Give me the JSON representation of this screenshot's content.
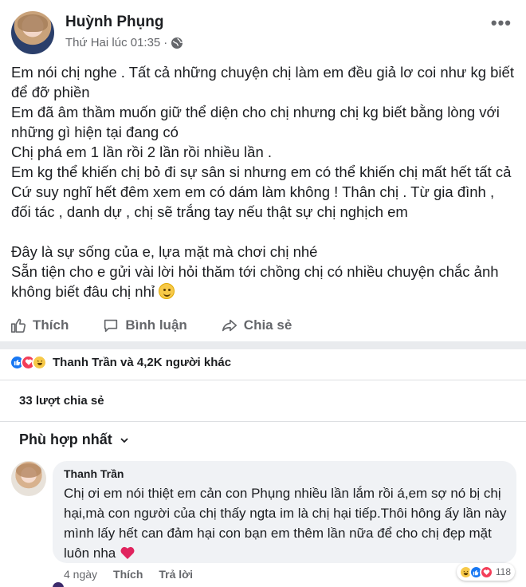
{
  "post": {
    "author": "Huỳnh Phụng",
    "timestamp": "Thứ Hai lúc 01:35",
    "separator": "·",
    "privacy_icon": "globe-icon",
    "more_icon": "more-options-icon",
    "body_lines": [
      "Em nói chị nghe . Tất cả những chuyện chị làm em đều giả lơ coi như kg biết để đỡ phiền",
      "Em đã âm thầm muốn giữ thể diện cho chị nhưng chị kg biết bằng lòng với những gì hiện tại đang có",
      "Chị phá em 1 lần rồi 2 lần rồi nhiều lần .",
      "Em kg thể khiến chị bỏ đi sự sân si nhưng em có thể khiến chị mất hết tất cả",
      "Cứ suy nghĩ hết đêm xem em có dám làm không ! Thân chị . Từ gia đình , đối tác , danh dự , chị sẽ trắng tay nếu thật sự chị nghịch em",
      "",
      "Đây là sự sống của e, lựa mặt mà chơi chị nhé",
      "Sẵn tiện cho e gửi vài lời hỏi thăm tới chồng chị có nhiều chuyện chắc ảnh không biết đâu chị nhỉ"
    ]
  },
  "actions": {
    "like": "Thích",
    "comment": "Bình luận",
    "share": "Chia sẻ"
  },
  "reactions": {
    "summary": "Thanh Trần và 4,2K người khác",
    "types": [
      "like",
      "love",
      "haha"
    ]
  },
  "shares": "33 lượt chia sẻ",
  "sort_label": "Phù hợp nhất",
  "comment": {
    "author": "Thanh Trần",
    "text": "Chị ơi em nói thiệt em cản con Phụng nhiều lần lắm rồi á,em sợ nó bị chị hại,mà con người của chị thấy ngta im là chị hại tiếp.Thôi hông ấy lần này mình lấy hết can đảm hại con bạn em thêm lần nữa để cho chị đẹp mặt luôn nha",
    "time": "4 ngày",
    "like": "Thích",
    "reply": "Trả lời",
    "reaction_count": "118"
  },
  "colors": {
    "like_blue": "#1877f2",
    "love_red": "#f33e58",
    "haha_yellow": "#f7c948",
    "secondary_text": "#65676b",
    "bubble_bg": "#f0f2f5"
  }
}
